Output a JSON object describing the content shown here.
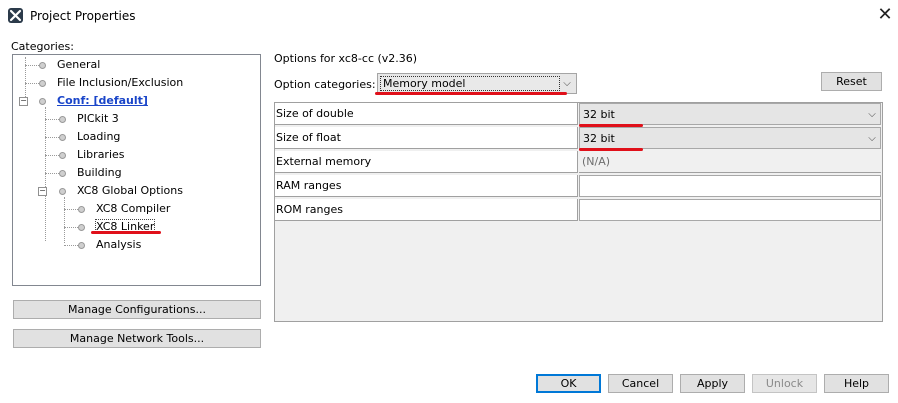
{
  "window": {
    "title": "Project Properties"
  },
  "categories": {
    "label": "Categories:",
    "items": [
      {
        "label": "General"
      },
      {
        "label": "File Inclusion/Exclusion"
      },
      {
        "label": "Conf: [default]"
      },
      {
        "label": "PICkit 3"
      },
      {
        "label": "Loading"
      },
      {
        "label": "Libraries"
      },
      {
        "label": "Building"
      },
      {
        "label": "XC8 Global Options"
      },
      {
        "label": "XC8 Compiler"
      },
      {
        "label": "XC8 Linker"
      },
      {
        "label": "Analysis"
      }
    ]
  },
  "left_buttons": {
    "manage_configurations": "Manage Configurations...",
    "manage_network_tools": "Manage Network Tools..."
  },
  "options": {
    "header": "Options for xc8-cc (v2.36)",
    "category_label": "Option categories:",
    "category_value": "Memory model",
    "reset_label": "Reset",
    "rows": [
      {
        "name": "Size of double",
        "value": "32 bit"
      },
      {
        "name": "Size of float",
        "value": "32 bit"
      },
      {
        "name": "External memory",
        "value": "(N/A)"
      },
      {
        "name": "RAM ranges",
        "value": ""
      },
      {
        "name": "ROM ranges",
        "value": ""
      }
    ]
  },
  "footer": {
    "ok": "OK",
    "cancel": "Cancel",
    "apply": "Apply",
    "unlock": "Unlock",
    "help": "Help"
  },
  "colors": {
    "annotation_red": "#e0101a",
    "selected_link": "#1a45c9",
    "default_button_border": "#0078d7"
  }
}
